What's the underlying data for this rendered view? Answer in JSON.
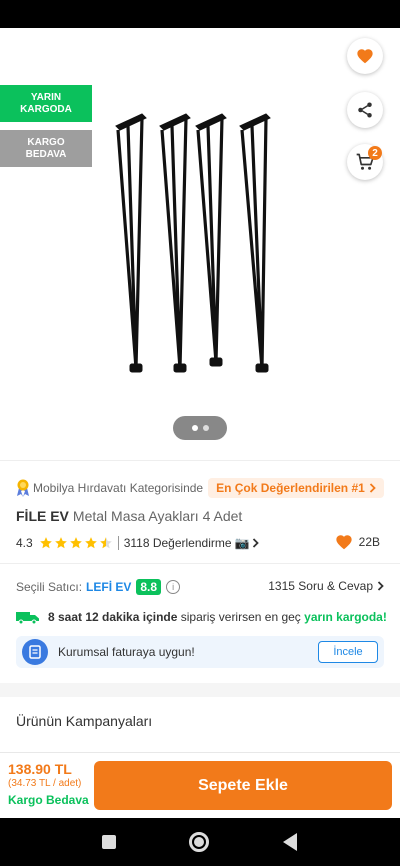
{
  "badges": {
    "next_day": "YARIN\nKARGODA",
    "free_ship": "KARGO\nBEDAVA"
  },
  "cart": {
    "count": "2"
  },
  "category": {
    "text": "Mobilya Hırdavatı Kategorisinde",
    "best": "En Çok Değerlendirilen #1"
  },
  "product": {
    "brand": "FİLE EV",
    "name": "Metal Masa Ayakları 4 Adet"
  },
  "rating": {
    "score": "4.3",
    "stars": 4.3,
    "reviews": "3118 Değerlendirme",
    "favorites": "22B"
  },
  "seller": {
    "label": "Seçili Satıcı:",
    "name": "LEFİ EV",
    "score": "8.8",
    "qa": "1315 Soru & Cevap"
  },
  "shipping": {
    "bold": "8 saat 12 dakika içinde",
    "middle": " sipariş verirsen en geç ",
    "green": "yarın kargoda!"
  },
  "invoice": {
    "text": "Kurumsal faturaya uygun!",
    "button": "İncele"
  },
  "campaigns": {
    "title": "Ürünün Kampanyaları"
  },
  "footer": {
    "price": "138.90 TL",
    "unit": "(34.73 TL / adet)",
    "shipping": "Kargo Bedava",
    "add_to_cart": "Sepete Ekle"
  },
  "colors": {
    "accent": "#f27a1a",
    "green": "#0bc15c",
    "blue": "#1e88e5"
  },
  "icons": [
    "back-arrow-icon",
    "heart-icon",
    "share-icon",
    "cart-icon",
    "medal-icon",
    "star-icon",
    "camera-icon",
    "info-icon",
    "truck-icon",
    "invoice-icon",
    "chevron-right-icon"
  ]
}
